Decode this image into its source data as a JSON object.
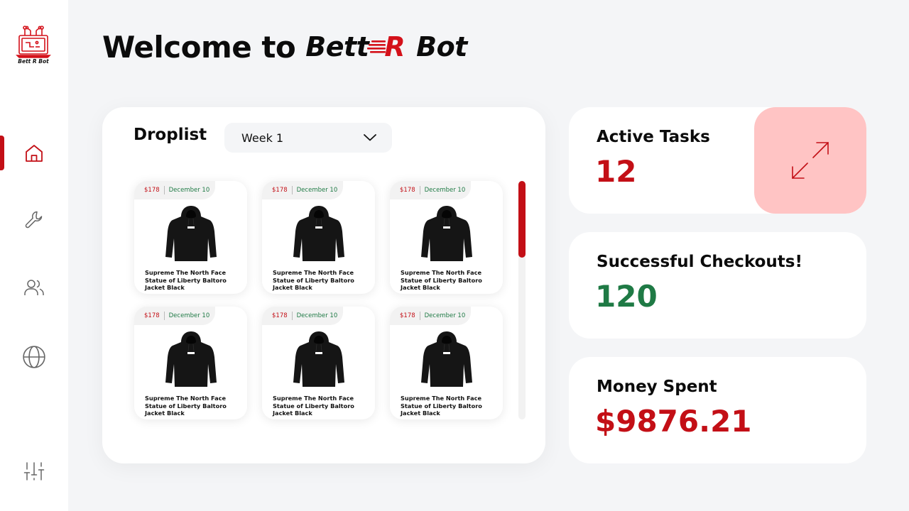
{
  "header": {
    "welcome_text": "Welcome to",
    "brand_part1": "Bett",
    "brand_r": "R",
    "brand_part2": "Bot"
  },
  "logo": {
    "text": "Bett R Bot"
  },
  "sidebar": {
    "items": [
      {
        "icon": "home-icon",
        "active": true
      },
      {
        "icon": "wrench-icon",
        "active": false
      },
      {
        "icon": "users-icon",
        "active": false
      },
      {
        "icon": "globe-icon",
        "active": false
      },
      {
        "icon": "sliders-icon",
        "active": false
      }
    ]
  },
  "droplist": {
    "title": "Droplist",
    "selected_week": "Week 1",
    "scroll_position": 0,
    "items": [
      {
        "price": "$178",
        "date": "December 10",
        "name": "Supreme The North Face Statue of Liberty Baltoro Jacket Black"
      },
      {
        "price": "$178",
        "date": "December 10",
        "name": "Supreme The North Face Statue of Liberty Baltoro Jacket Black"
      },
      {
        "price": "$178",
        "date": "December 10",
        "name": "Supreme The North Face Statue of Liberty Baltoro Jacket Black"
      },
      {
        "price": "$178",
        "date": "December 10",
        "name": "Supreme The North Face Statue of Liberty Baltoro Jacket Black"
      },
      {
        "price": "$178",
        "date": "December 10",
        "name": "Supreme The North Face Statue of Liberty Baltoro Jacket Black"
      },
      {
        "price": "$178",
        "date": "December 10",
        "name": "Supreme The North Face Statue of Liberty Baltoro Jacket Black"
      }
    ]
  },
  "stats": {
    "active_tasks": {
      "label": "Active Tasks",
      "value": "12"
    },
    "checkouts": {
      "label": "Successful Checkouts!",
      "value": "120"
    },
    "money": {
      "label": "Money Spent",
      "value": "$9876.21"
    }
  },
  "colors": {
    "accent_red": "#c30f16",
    "success_green": "#1f7a45",
    "expand_bg": "#ffc4c4",
    "background": "#f4f5f7"
  }
}
